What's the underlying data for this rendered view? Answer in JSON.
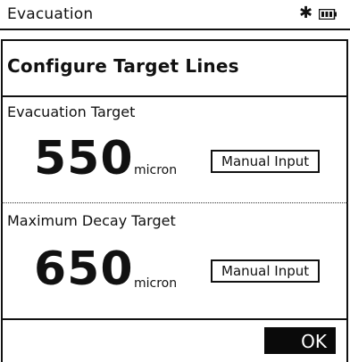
{
  "status_bar": {
    "title": "Evacuation",
    "bluetooth_icon": "bluetooth-icon",
    "battery_icon": "battery-icon"
  },
  "screen": {
    "heading": "Configure Target Lines"
  },
  "evacuation_target": {
    "label": "Evacuation Target",
    "value": "550",
    "unit": "micron",
    "button_label": "Manual Input"
  },
  "decay_target": {
    "label": "Maximum Decay Target",
    "value": "650",
    "unit": "micron",
    "button_label": "Manual Input"
  },
  "footer": {
    "ok_label": "OK"
  }
}
